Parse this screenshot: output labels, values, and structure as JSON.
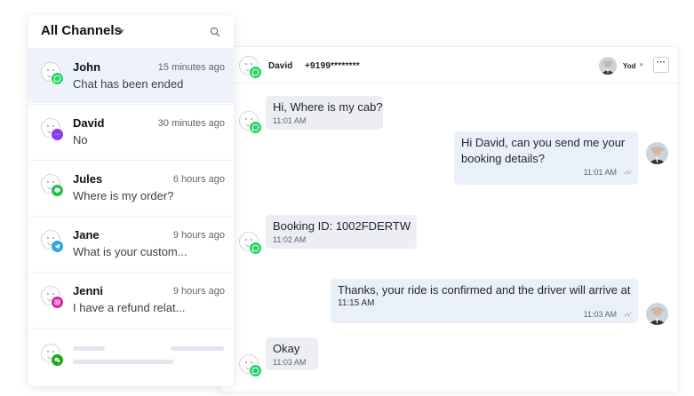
{
  "sidebar": {
    "title": "All Channels",
    "conversations": [
      {
        "name": "John",
        "time": "15 minutes ago",
        "preview": "Chat has been ended",
        "channel": "whatsapp-icon",
        "color": "#25d366"
      },
      {
        "name": "David",
        "time": "30 minutes ago",
        "preview": "No",
        "channel": "messenger-icon",
        "color": "#8a3cf5"
      },
      {
        "name": "Jules",
        "time": "6 hours ago",
        "preview": "Where is my order?",
        "channel": "line-icon",
        "color": "#1fc24c"
      },
      {
        "name": "Jane",
        "time": "9 hours ago",
        "preview": "What is your custom...",
        "channel": "telegram-icon",
        "color": "#2ca5e0"
      },
      {
        "name": "Jenni",
        "time": "9 hours ago",
        "preview": "I have a refund relat...",
        "channel": "instagram-icon",
        "color": "#d6249f"
      }
    ],
    "placeholder_channel": "wechat-icon"
  },
  "chat": {
    "contact_name": "David",
    "contact_phone": "+9199********",
    "agent_name": "Yod",
    "more_label": "···",
    "messages": [
      {
        "dir": "in",
        "text": "Hi, Where is my cab?",
        "time": "11:01 AM"
      },
      {
        "dir": "out",
        "text": "Hi David, can you send me your",
        "text2": "booking details?",
        "time": "11:01 AM"
      },
      {
        "dir": "in",
        "text": "Booking ID: 1002FDERTW",
        "time": "11:02 AM"
      },
      {
        "dir": "out",
        "text": "Thanks, your ride is confirmed and the driver will arrive at",
        "text2": "11:15 AM",
        "time": "11:03 AM"
      },
      {
        "dir": "in",
        "text": "Okay",
        "time": "11:03 AM"
      }
    ]
  },
  "colors": {
    "whatsapp": "#25d366",
    "active_row": "#eef3fb",
    "bubble_in": "#eceef3",
    "bubble_out": "#eaf0fa"
  }
}
